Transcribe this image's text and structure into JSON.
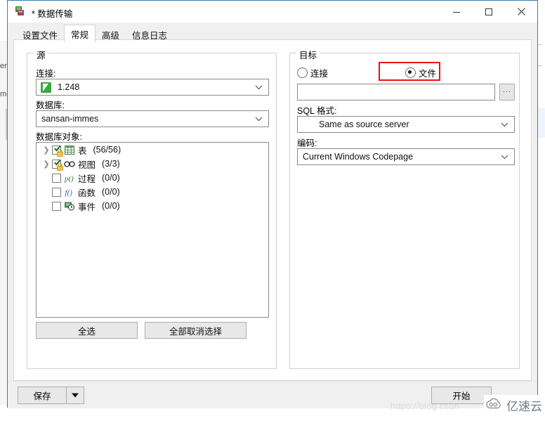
{
  "window": {
    "title": "* 数据传输",
    "icon": "data-transfer-icon",
    "controls": {
      "minimize": "minimize-icon",
      "maximize": "maximize-icon",
      "close": "close-icon"
    }
  },
  "tabs": [
    {
      "label": "设置文件",
      "active": false
    },
    {
      "label": "常规",
      "active": true
    },
    {
      "label": "高级",
      "active": false
    },
    {
      "label": "信息日志",
      "active": false
    }
  ],
  "source": {
    "legend": "源",
    "connection_label": "连接:",
    "connection_value": "1.248",
    "connection_icon": "green-connection-icon",
    "database_label": "数据库:",
    "database_value": "sansan-immes",
    "objects_label": "数据库对象:",
    "tree": [
      {
        "expander": "chevron-right-icon",
        "checked": true,
        "locked": true,
        "icon": "table-icon",
        "label": "表",
        "count": "(56/56)"
      },
      {
        "expander": "chevron-right-icon",
        "checked": true,
        "locked": true,
        "icon": "view-icon",
        "label": "视图",
        "count": "(3/3)"
      },
      {
        "expander": "",
        "checked": false,
        "locked": false,
        "icon": "procedure-icon",
        "label": "过程",
        "count": "(0/0)"
      },
      {
        "expander": "",
        "checked": false,
        "locked": false,
        "icon": "function-icon",
        "label": "函数",
        "count": "(0/0)"
      },
      {
        "expander": "",
        "checked": false,
        "locked": false,
        "icon": "event-icon",
        "label": "事件",
        "count": "(0/0)"
      }
    ],
    "select_all": "全选",
    "deselect_all": "全部取消选择"
  },
  "target": {
    "legend": "目标",
    "radio_connection": "连接",
    "radio_file": "文件",
    "selected_radio": "文件",
    "file_path_value": "",
    "browse_button": "...",
    "sql_format_label": "SQL 格式:",
    "sql_format_value": "Same as source server",
    "encoding_label": "编码:",
    "encoding_value": "Current Windows Codepage",
    "highlight_color": "#ee1111"
  },
  "footer": {
    "save_label": "保存",
    "save_dropdown_icon": "caret-down-icon",
    "start_label": "开始"
  },
  "background": {
    "text_top": "er",
    "text_bottom": "me"
  },
  "watermark": {
    "url": "https://blog.csdn",
    "brand": "亿速云",
    "brand_icon": "cloud-icon"
  }
}
